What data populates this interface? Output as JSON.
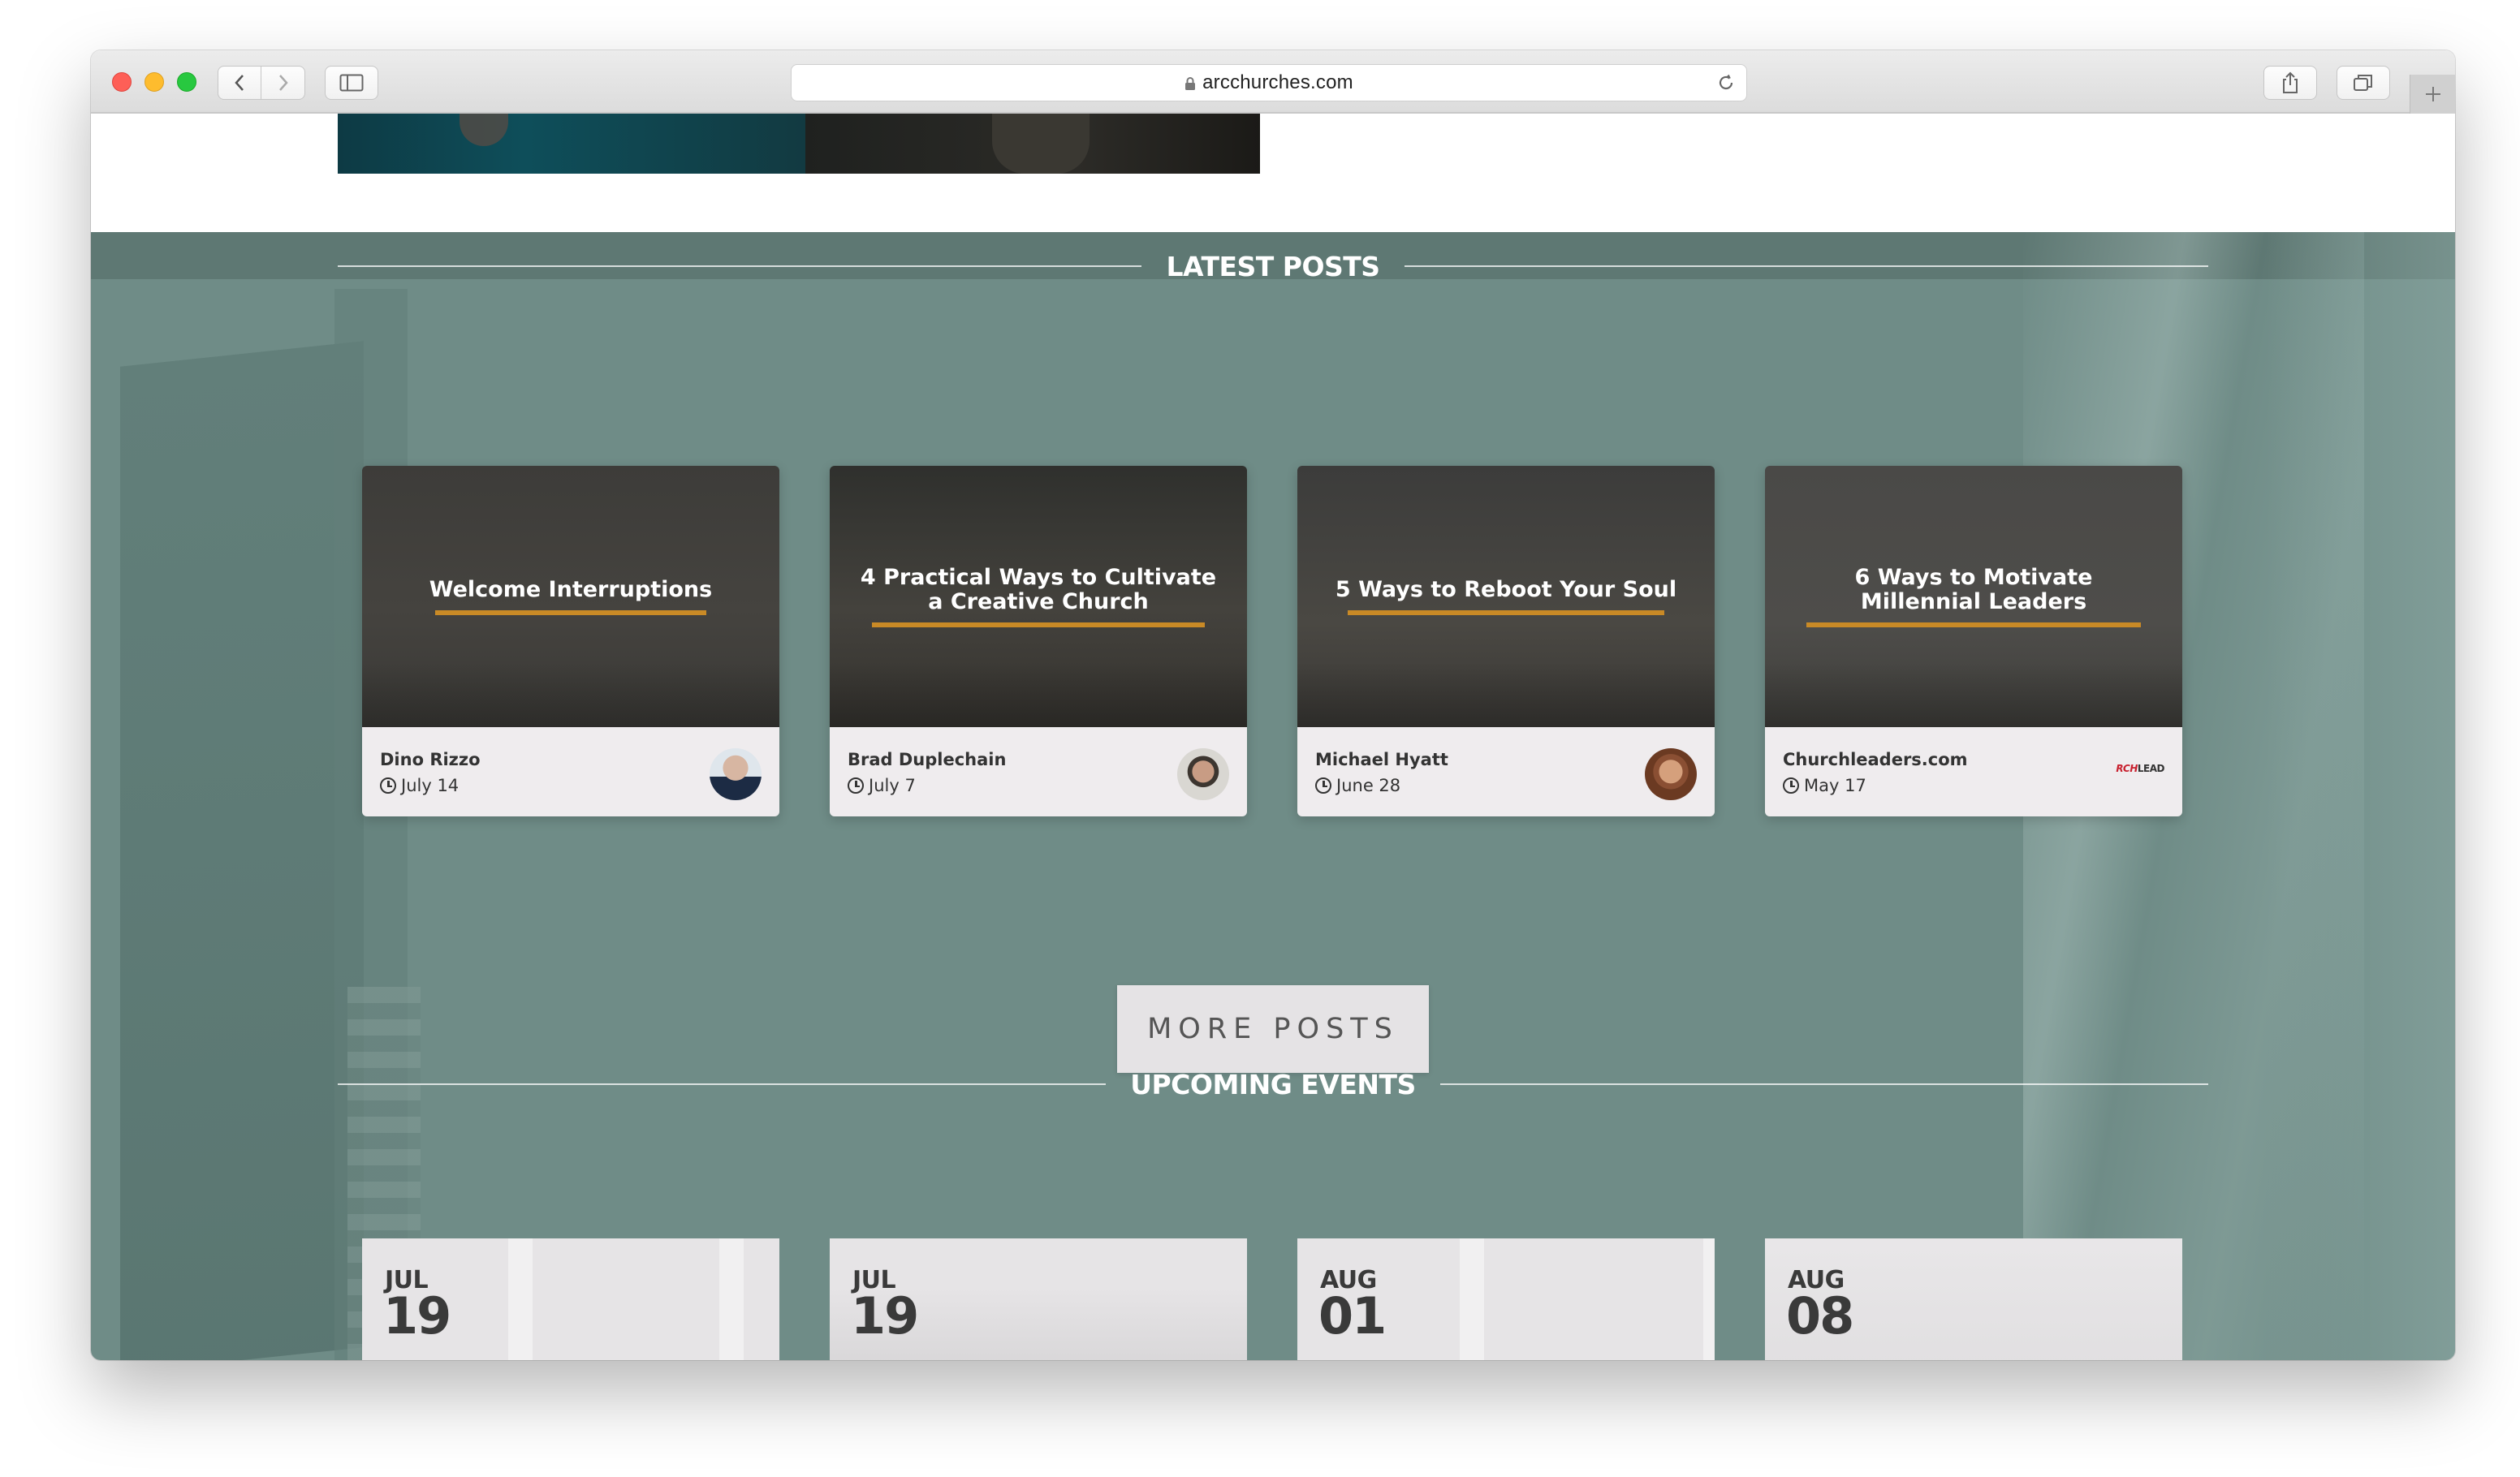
{
  "browser": {
    "url": "arcchurches.com"
  },
  "sections": {
    "posts_heading": "LATEST POSTS",
    "events_heading": "UPCOMING EVENTS"
  },
  "posts": [
    {
      "title": "Welcome Interruptions",
      "author": "Dino Rizzo",
      "date": "July 14",
      "avatar": "avatar-dino-rizzo"
    },
    {
      "title": "4 Practical Ways to Cultivate\na Creative Church",
      "author": "Brad Duplechain",
      "date": "July 7",
      "avatar": "avatar-brad-duplechain"
    },
    {
      "title": "5 Ways to Reboot Your Soul",
      "author": "Michael Hyatt",
      "date": "June 28",
      "avatar": "avatar-michael-hyatt"
    },
    {
      "title": "6 Ways to Motivate\nMillennial Leaders",
      "author": "Churchleaders.com",
      "date": "May 17",
      "logo": {
        "part1": "RCH",
        "part2": "LEAD"
      }
    }
  ],
  "more_posts_label": "MORE POSTS",
  "events": [
    {
      "month": "JUL",
      "day": "19"
    },
    {
      "month": "JUL",
      "day": "19"
    },
    {
      "month": "AUG",
      "day": "01"
    },
    {
      "month": "AUG",
      "day": "08"
    }
  ],
  "colors": {
    "section_bg": "#6f8c87",
    "accent_underline": "#c98a26",
    "card_footer": "#efecee"
  }
}
